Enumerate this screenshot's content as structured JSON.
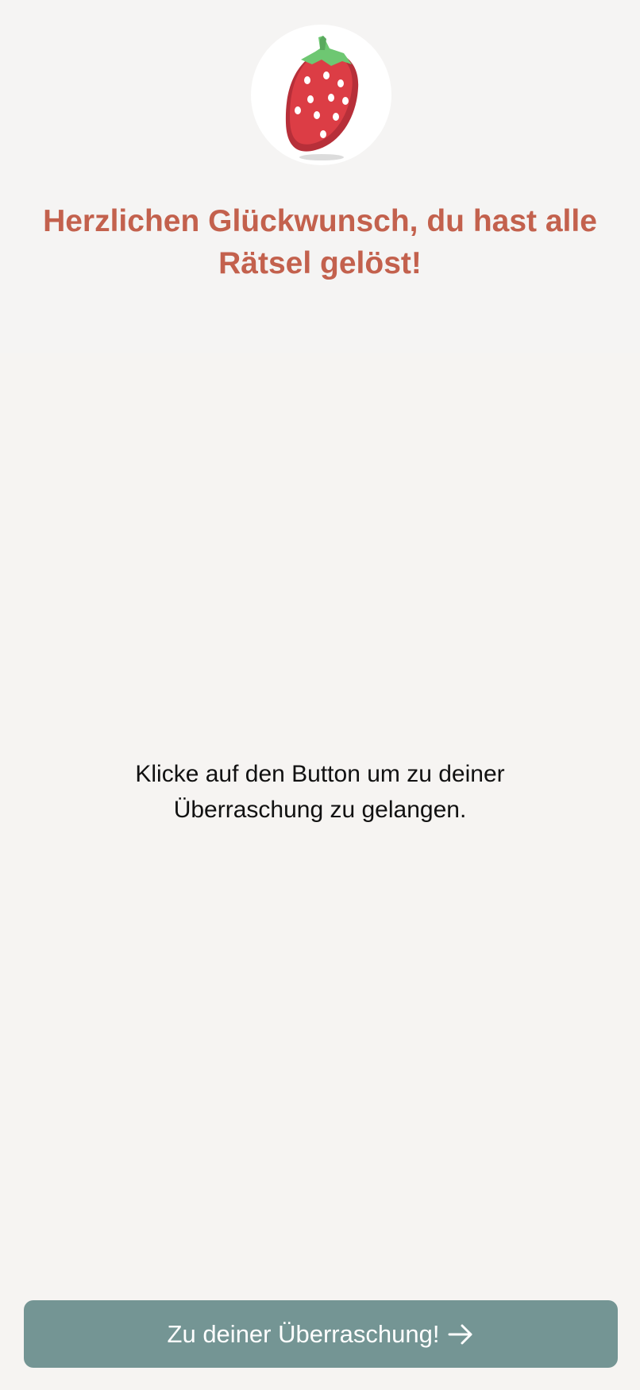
{
  "header": {
    "icon": "strawberry-icon",
    "title": "Herzlichen Glückwunsch, du hast alle Rätsel gelöst!"
  },
  "main": {
    "message": "Klicke auf den Button um zu deiner Überraschung zu gelangen."
  },
  "cta": {
    "label": "Zu deiner Überraschung!",
    "icon": "arrow-right-icon"
  },
  "colors": {
    "title": "#c3614d",
    "button": "#749594",
    "background": "#f6f4f2"
  }
}
